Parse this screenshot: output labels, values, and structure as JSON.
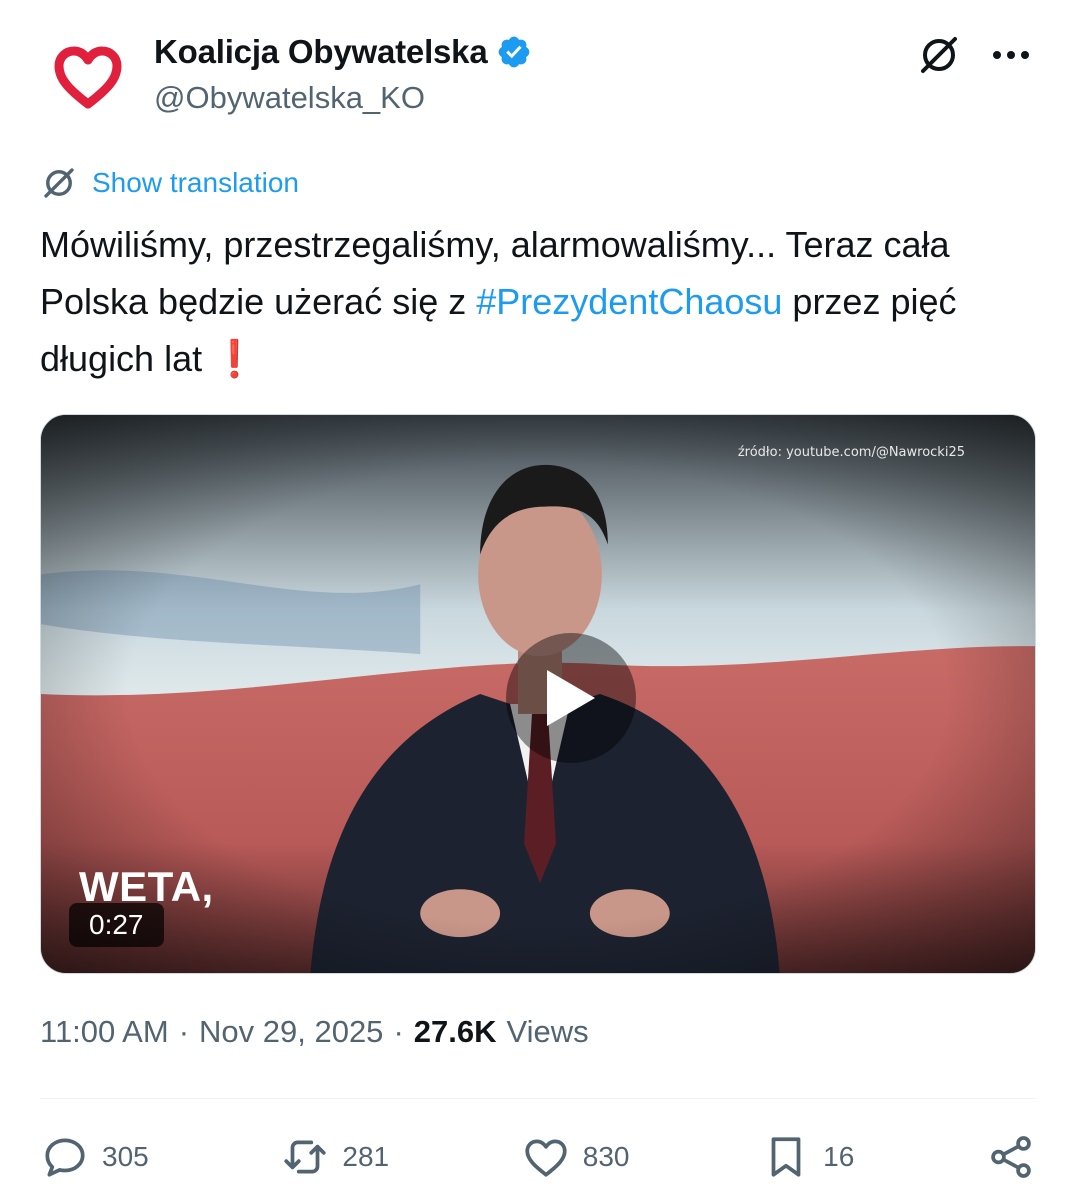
{
  "author": {
    "name": "Koalicja Obywatelska",
    "handle": "@Obywatelska_KO",
    "verified": true,
    "avatar_icon": "heart-icon",
    "avatar_color": "#e0203c"
  },
  "top_actions": [
    "grok-icon",
    "more-icon"
  ],
  "translation": {
    "label": "Show translation"
  },
  "text": {
    "part1": "Mówiliśmy, przestrzegaliśmy, alarmowaliśmy... Teraz cała Polska będzie użerać się z ",
    "hashtag": "#PrezydentChaosu",
    "part2": " przez pięć długich lat ",
    "emoji": "❗"
  },
  "media": {
    "source": "źródło: youtube.com/@Nawrocki25",
    "overlay_word": "WETA,",
    "duration": "0:27"
  },
  "meta": {
    "time": "11:00 AM",
    "date": "Nov 29, 2025",
    "views_count": "27.6K",
    "views_label": "Views",
    "separator": "·"
  },
  "stats": {
    "replies": "305",
    "reposts": "281",
    "likes": "830",
    "bookmarks": "16"
  },
  "colors": {
    "accent": "#1d9bf0",
    "text": "#0f1419",
    "secondary": "#536471"
  }
}
